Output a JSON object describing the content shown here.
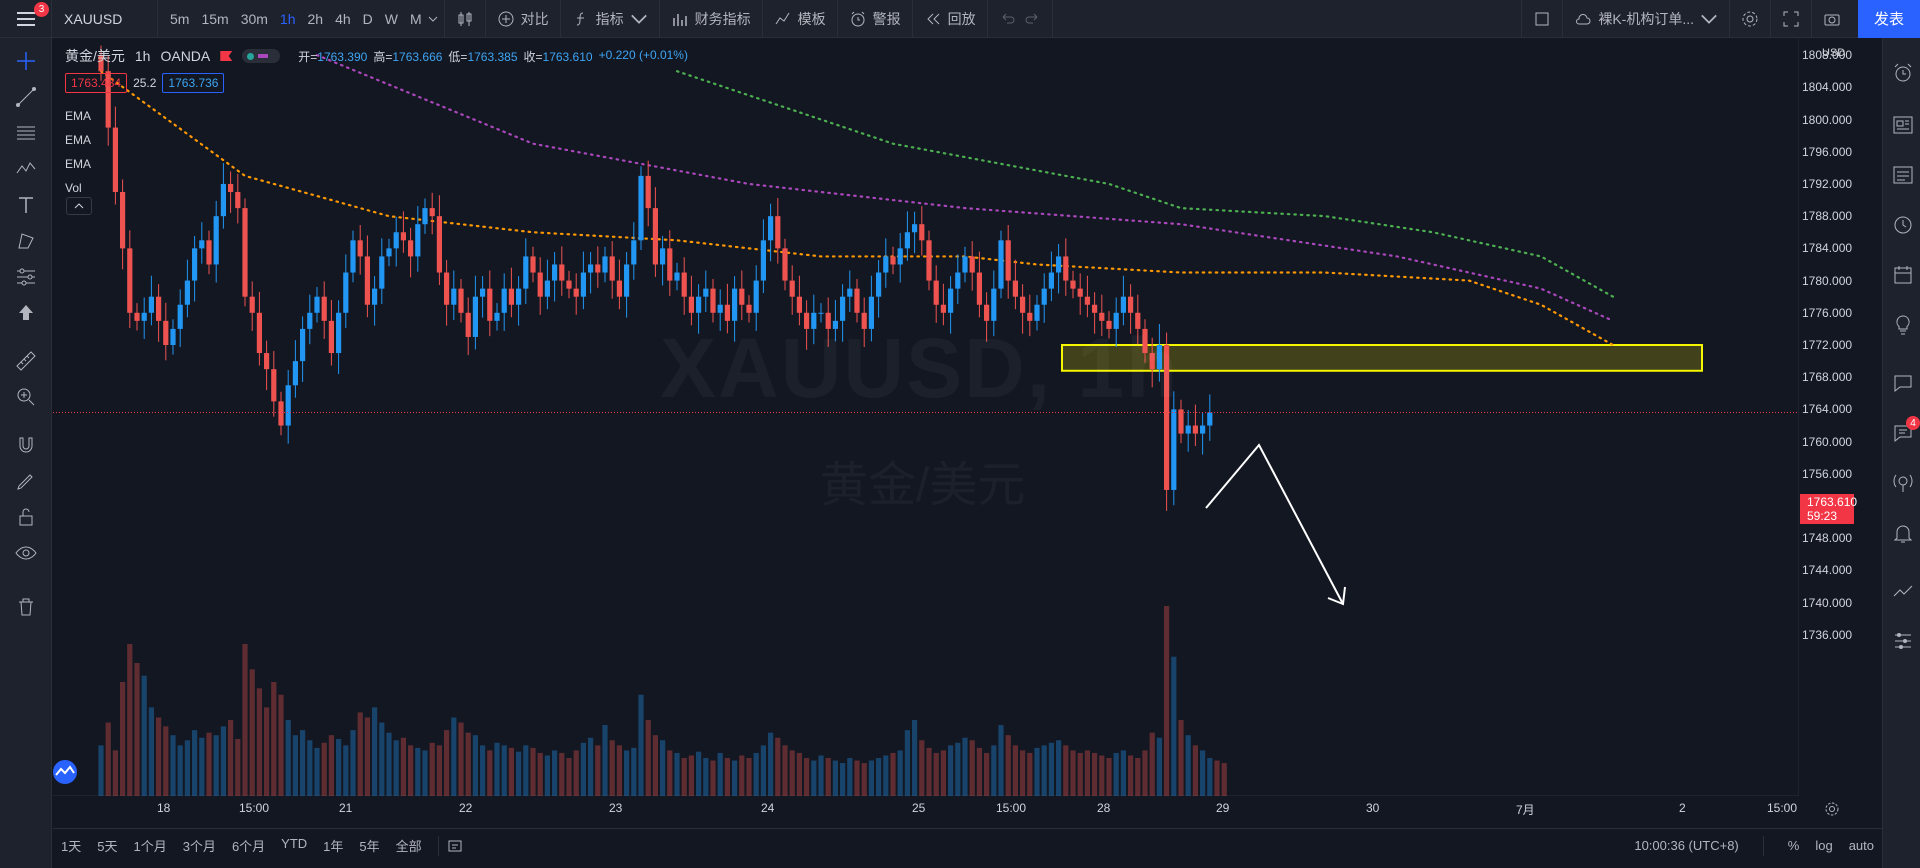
{
  "topbar": {
    "notifications": "3",
    "symbol": "XAUUSD",
    "intervals": [
      "5m",
      "15m",
      "30m",
      "1h",
      "2h",
      "4h",
      "D",
      "W",
      "M"
    ],
    "active_interval": "1h",
    "compare_label": "对比",
    "indicators_label": "指标",
    "financials_label": "财务指标",
    "templates_label": "模板",
    "alerts_label": "警报",
    "replay_label": "回放",
    "layout_name": "裸K-机构订单...",
    "publish_label": "发表"
  },
  "legend": {
    "title": "黄金/美元",
    "interval": "1h",
    "exchange": "OANDA",
    "open_label": "开=",
    "open": "1763.390",
    "high_label": "高=",
    "high": "1763.666",
    "low_label": "低=",
    "low": "1763.385",
    "close_label": "收=",
    "close": "1763.610",
    "change": "+0.220 (+0.01%)",
    "bid": "1763.484",
    "spread": "25.2",
    "ask": "1763.736",
    "indicators": [
      "EMA",
      "EMA",
      "EMA",
      "Vol"
    ]
  },
  "watermark": {
    "symbol": "XAUUSD, 1h",
    "name": "黄金/美元"
  },
  "price_axis": {
    "currency": "USD",
    "labels": [
      "1808.000",
      "1804.000",
      "1800.000",
      "1796.000",
      "1792.000",
      "1788.000",
      "1784.000",
      "1780.000",
      "1776.000",
      "1772.000",
      "1768.000",
      "1764.000",
      "1760.000",
      "1756.000",
      "1752.000",
      "1748.000",
      "1744.000",
      "1740.000",
      "1736.000"
    ],
    "last_price": "1763.610",
    "countdown": "59:23"
  },
  "time_axis": [
    "18",
    "15:00",
    "21",
    "22",
    "23",
    "24",
    "25",
    "15:00",
    "28",
    "29",
    "30",
    "7月",
    "2",
    "15:00"
  ],
  "bottombar": {
    "ranges": [
      "1天",
      "5天",
      "1个月",
      "3个月",
      "6个月",
      "YTD",
      "1年",
      "5年",
      "全部"
    ],
    "clock": "10:00:36 (UTC+8)",
    "percent": "%",
    "log": "log",
    "auto": "auto"
  },
  "colors": {
    "background": "#131722",
    "up": "#2196f3",
    "down": "#ef5350",
    "ema_fast": "#ff9800",
    "ema_mid": "#ab47bc",
    "ema_slow": "#4caf50",
    "zone_fill": "#4a4a1a",
    "zone_border": "#f5f500",
    "accent": "#2962ff"
  },
  "chart_data": {
    "type": "candlestick",
    "symbol": "XAUUSD",
    "ylim": [
      1734,
      1810
    ],
    "zone": {
      "from": 1768.8,
      "to": 1772.0
    },
    "series": [
      {
        "name": "EMA",
        "points": [
          [
            0,
            1806
          ],
          [
            20,
            1793
          ],
          [
            40,
            1788
          ],
          [
            60,
            1786
          ],
          [
            80,
            1785
          ],
          [
            100,
            1783
          ],
          [
            120,
            1783
          ],
          [
            130,
            1782
          ],
          [
            150,
            1781
          ],
          [
            170,
            1781
          ],
          [
            190,
            1780
          ],
          [
            200,
            1777
          ],
          [
            210,
            1772
          ]
        ]
      },
      {
        "name": "EMA",
        "points": [
          [
            30,
            1808
          ],
          [
            60,
            1797
          ],
          [
            90,
            1792
          ],
          [
            120,
            1789
          ],
          [
            150,
            1787
          ],
          [
            165,
            1785
          ],
          [
            180,
            1783
          ],
          [
            190,
            1781
          ],
          [
            200,
            1779
          ],
          [
            210,
            1775
          ]
        ]
      },
      {
        "name": "EMA",
        "points": [
          [
            80,
            1806
          ],
          [
            110,
            1797
          ],
          [
            140,
            1792
          ],
          [
            150,
            1789
          ],
          [
            170,
            1788
          ],
          [
            185,
            1786
          ],
          [
            200,
            1783
          ],
          [
            210,
            1778
          ]
        ]
      }
    ],
    "closes": [
      1806,
      1799,
      1791,
      1784,
      1776,
      1775,
      1776,
      1778,
      1775,
      1772,
      1774,
      1777,
      1780,
      1784,
      1785,
      1782,
      1788,
      1792,
      1791,
      1789,
      1778,
      1776,
      1771,
      1769,
      1765,
      1762,
      1767,
      1770,
      1774,
      1776,
      1778,
      1775,
      1771,
      1776,
      1781,
      1785,
      1783,
      1777,
      1779,
      1783,
      1784,
      1786,
      1785,
      1783,
      1787,
      1789,
      1788,
      1781,
      1777,
      1779,
      1776,
      1773,
      1778,
      1779,
      1775,
      1776,
      1779,
      1777,
      1779,
      1783,
      1781,
      1778,
      1780,
      1782,
      1780,
      1779,
      1778,
      1781,
      1782,
      1781,
      1783,
      1780,
      1778,
      1782,
      1785,
      1793,
      1789,
      1782,
      1784,
      1780,
      1781,
      1778,
      1776,
      1778,
      1779,
      1776,
      1777,
      1775,
      1779,
      1777,
      1776,
      1780,
      1785,
      1788,
      1784,
      1780,
      1778,
      1776,
      1774,
      1776,
      1776,
      1774,
      1775,
      1778,
      1779,
      1776,
      1774,
      1778,
      1781,
      1783,
      1782,
      1784,
      1786,
      1787,
      1785,
      1780,
      1777,
      1776,
      1779,
      1781,
      1783,
      1781,
      1777,
      1775,
      1779,
      1785,
      1780,
      1778,
      1776,
      1775,
      1777,
      1779,
      1781,
      1783,
      1780,
      1779,
      1778,
      1777,
      1776,
      1775,
      1774,
      1776,
      1778,
      1776,
      1774,
      1771,
      1769,
      1772,
      1754,
      1764,
      1761,
      1762,
      1761,
      1762,
      1763.61
    ],
    "volumes": [
      40,
      58,
      36,
      90,
      120,
      105,
      95,
      70,
      62,
      55,
      48,
      40,
      44,
      52,
      46,
      50,
      48,
      55,
      60,
      45,
      120,
      100,
      85,
      70,
      90,
      80,
      60,
      48,
      52,
      44,
      38,
      42,
      48,
      45,
      40,
      52,
      66,
      62,
      70,
      58,
      50,
      44,
      46,
      40,
      38,
      36,
      42,
      40,
      52,
      62,
      58,
      50,
      48,
      40,
      36,
      42,
      40,
      38,
      35,
      40,
      38,
      34,
      32,
      36,
      34,
      30,
      36,
      42,
      46,
      40,
      56,
      44,
      40,
      36,
      38,
      80,
      60,
      48,
      44,
      36,
      34,
      30,
      32,
      35,
      30,
      28,
      34,
      30,
      28,
      32,
      30,
      34,
      40,
      50,
      46,
      40,
      36,
      34,
      30,
      28,
      32,
      30,
      28,
      26,
      30,
      28,
      26,
      28,
      30,
      32,
      34,
      36,
      52,
      60,
      44,
      38,
      34,
      36,
      40,
      42,
      46,
      44,
      38,
      34,
      40,
      56,
      48,
      40,
      36,
      34,
      38,
      40,
      42,
      44,
      40,
      36,
      34,
      36,
      34,
      32,
      30,
      34,
      36,
      32,
      30,
      36,
      50,
      46,
      150,
      110,
      60,
      48,
      40,
      36,
      30,
      28,
      26
    ]
  }
}
